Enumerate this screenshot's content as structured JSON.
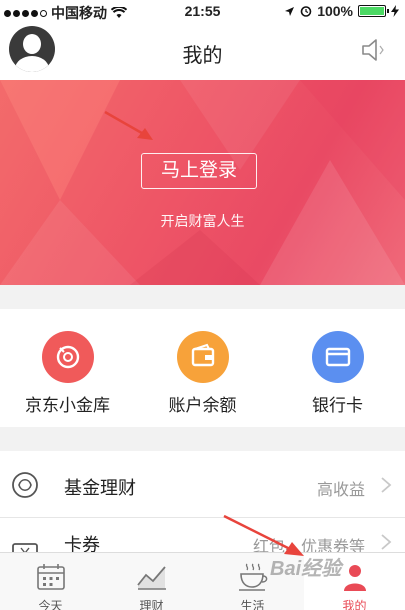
{
  "status_bar": {
    "carrier": "中国移动",
    "time": "21:55",
    "battery": "100%",
    "battery_level": 1.0
  },
  "header": {
    "title": "我的"
  },
  "banner": {
    "login_label": "马上登录",
    "subtitle": "开启财富人生"
  },
  "quick_actions": [
    {
      "label": "京东小金库",
      "icon": "vault-icon",
      "color": "#f05a5a"
    },
    {
      "label": "账户余额",
      "icon": "wallet-icon",
      "color": "#f7a23a"
    },
    {
      "label": "银行卡",
      "icon": "bank-card-icon",
      "color": "#5b8ff0"
    }
  ],
  "list": [
    {
      "label": "基金理财",
      "value": "高收益",
      "icon": "fund-icon"
    },
    {
      "label": "卡券",
      "value": "红包、优惠券等",
      "icon": "coupon-icon"
    }
  ],
  "tabbar": [
    {
      "label": "今天",
      "icon": "calendar-icon"
    },
    {
      "label": "理财",
      "icon": "chart-icon"
    },
    {
      "label": "生活",
      "icon": "coffee-icon"
    },
    {
      "label": "我的",
      "icon": "profile-icon",
      "active": true
    }
  ],
  "watermark": "Bai经验",
  "colors": {
    "accent": "#e94a56",
    "banner": "#ee5566",
    "battery": "#4cd964"
  }
}
